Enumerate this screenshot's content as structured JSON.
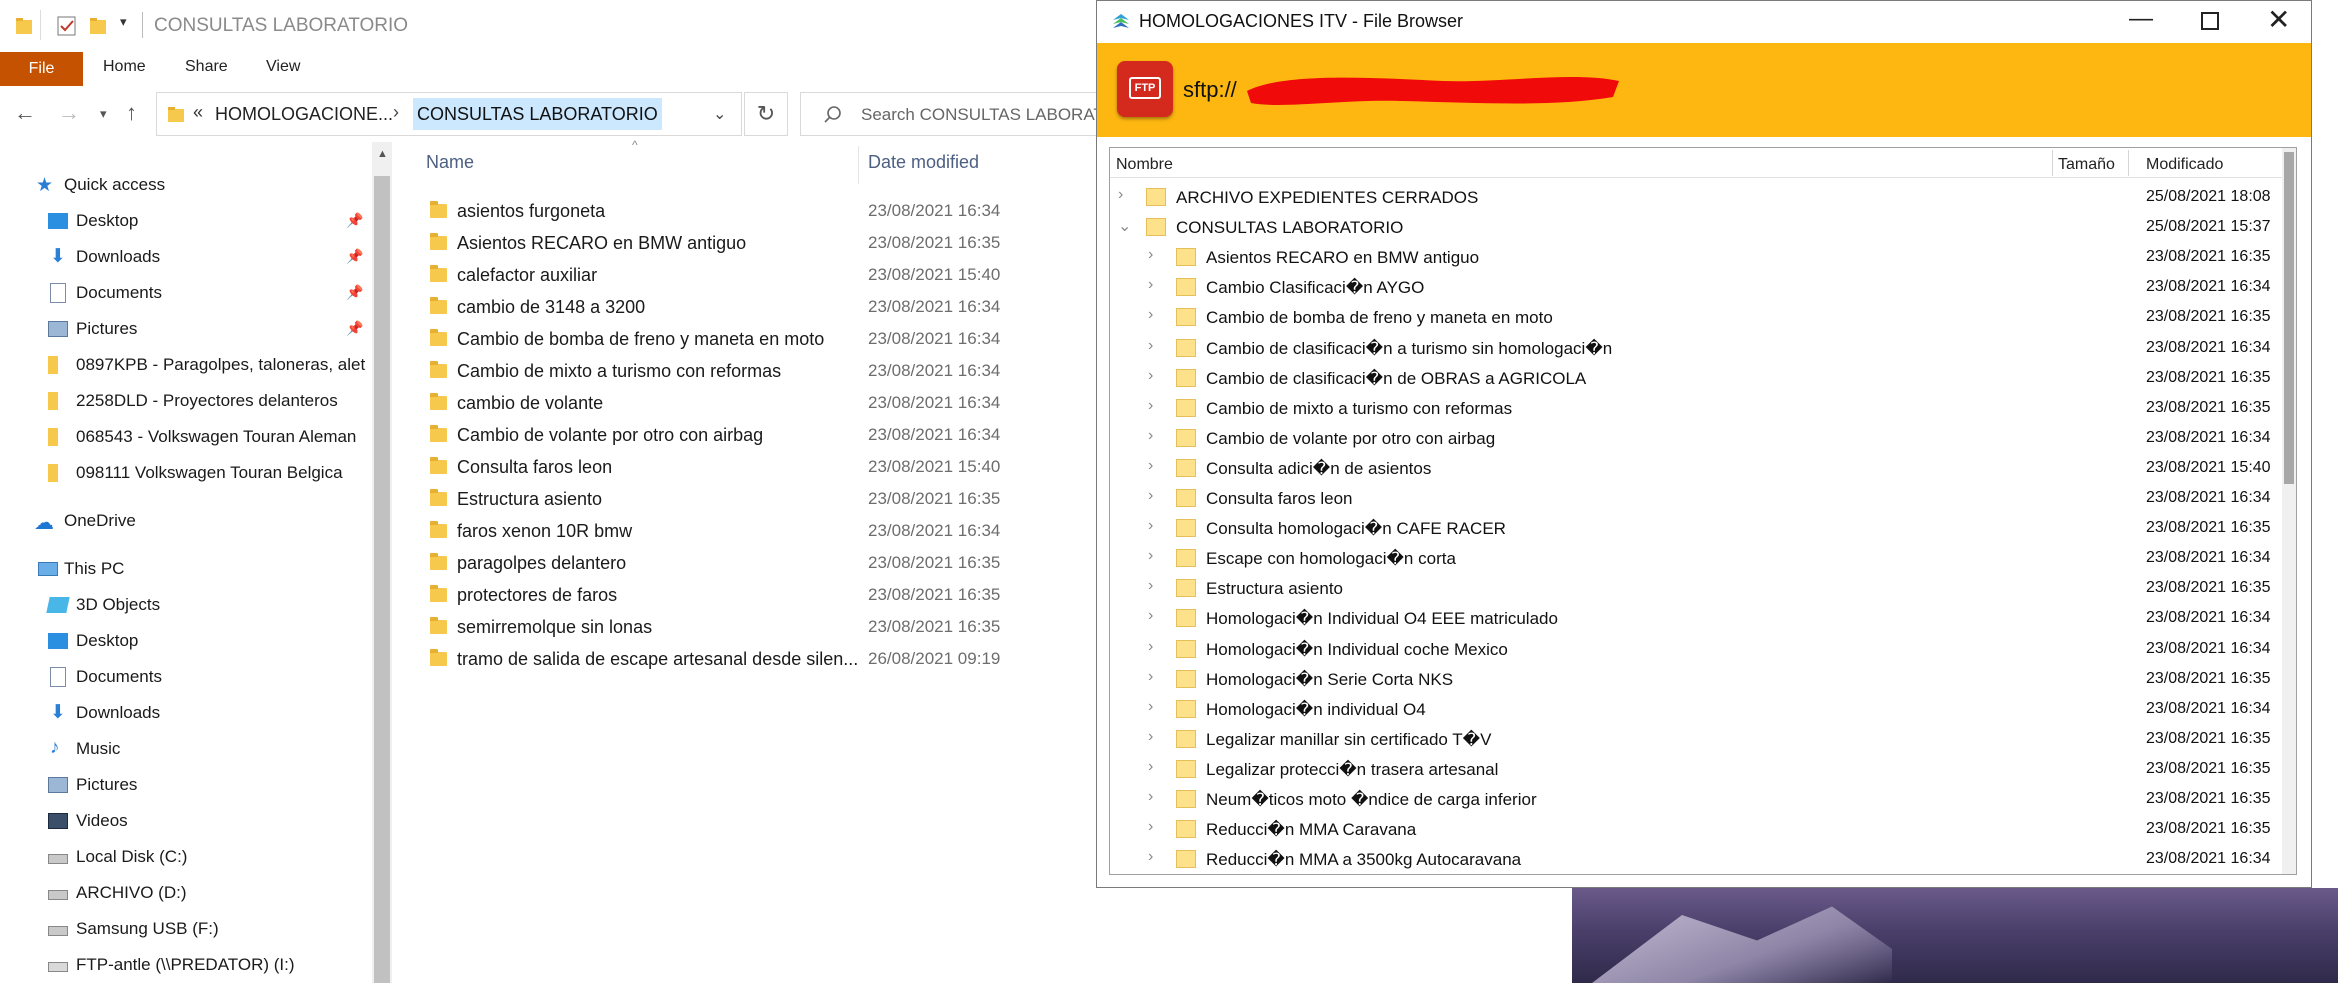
{
  "explorer": {
    "title": "CONSULTAS LABORATORIO",
    "ribbon": {
      "file": "File",
      "home": "Home",
      "share": "Share",
      "view": "View"
    },
    "address": {
      "chevron": "«",
      "crumb1": "HOMOLOGACIONE...",
      "sep": "›",
      "crumb2": "CONSULTAS LABORATORIO"
    },
    "search_placeholder": "Search CONSULTAS LABORAT",
    "nav": {
      "quick_access": "Quick access",
      "pinned": [
        "Desktop",
        "Downloads",
        "Documents",
        "Pictures"
      ],
      "recent": [
        "0897KPB - Paragolpes, taloneras, alet",
        "2258DLD - Proyectores delanteros",
        "068543 - Volkswagen Touran Aleman",
        "098111 Volkswagen Touran Belgica"
      ],
      "onedrive": "OneDrive",
      "this_pc": "This PC",
      "pc_items": [
        "3D Objects",
        "Desktop",
        "Documents",
        "Downloads",
        "Music",
        "Pictures",
        "Videos",
        "Local Disk (C:)",
        "ARCHIVO (D:)",
        "Samsung USB (F:)",
        "FTP-antle (\\\\PREDATOR) (I:)"
      ]
    },
    "columns": {
      "name": "Name",
      "date": "Date modified"
    },
    "files": [
      {
        "name": "asientos furgoneta",
        "date": "23/08/2021 16:34"
      },
      {
        "name": "Asientos RECARO en BMW antiguo",
        "date": "23/08/2021 16:35"
      },
      {
        "name": "calefactor auxiliar",
        "date": "23/08/2021 15:40"
      },
      {
        "name": "cambio de 3148 a 3200",
        "date": "23/08/2021 16:34"
      },
      {
        "name": "Cambio de bomba de freno y maneta en moto",
        "date": "23/08/2021 16:34"
      },
      {
        "name": "Cambio de mixto a turismo con reformas",
        "date": "23/08/2021 16:34"
      },
      {
        "name": "cambio de volante",
        "date": "23/08/2021 16:34"
      },
      {
        "name": "Cambio de volante por otro con airbag",
        "date": "23/08/2021 16:34"
      },
      {
        "name": "Consulta faros leon",
        "date": "23/08/2021 15:40"
      },
      {
        "name": "Estructura asiento",
        "date": "23/08/2021 16:35"
      },
      {
        "name": "faros xenon 10R bmw",
        "date": "23/08/2021 16:34"
      },
      {
        "name": "paragolpes delantero",
        "date": "23/08/2021 16:35"
      },
      {
        "name": "protectores de faros",
        "date": "23/08/2021 16:35"
      },
      {
        "name": "semirremolque sin lonas",
        "date": "23/08/2021 16:35"
      },
      {
        "name": "tramo de salida de escape artesanal desde silen...",
        "date": "26/08/2021 09:19"
      }
    ]
  },
  "filebrowser": {
    "title": "HOMOLOGACIONES ITV - File Browser",
    "url_prefix": "sftp://",
    "columns": {
      "name": "Nombre",
      "size": "Tamaño",
      "modified": "Modificado"
    },
    "root_items": [
      {
        "name": "ARCHIVO EXPEDIENTES CERRADOS",
        "date": "25/08/2021 18:08",
        "expanded": false
      },
      {
        "name": "CONSULTAS LABORATORIO",
        "date": "25/08/2021 15:37",
        "expanded": true
      }
    ],
    "children": [
      {
        "name": "Asientos RECARO en BMW antiguo",
        "date": "23/08/2021 16:35"
      },
      {
        "name": "Cambio Clasificaci�n AYGO",
        "date": "23/08/2021 16:34"
      },
      {
        "name": "Cambio de bomba de freno y maneta en moto",
        "date": "23/08/2021 16:35"
      },
      {
        "name": "Cambio de clasificaci�n a turismo sin homologaci�n",
        "date": "23/08/2021 16:34"
      },
      {
        "name": "Cambio de clasificaci�n de OBRAS a AGRICOLA",
        "date": "23/08/2021 16:35"
      },
      {
        "name": "Cambio de mixto a turismo con reformas",
        "date": "23/08/2021 16:35"
      },
      {
        "name": "Cambio de volante por otro con airbag",
        "date": "23/08/2021 16:34"
      },
      {
        "name": "Consulta adici�n de asientos",
        "date": "23/08/2021 15:40"
      },
      {
        "name": "Consulta faros leon",
        "date": "23/08/2021 16:34"
      },
      {
        "name": "Consulta homologaci�n CAFE RACER",
        "date": "23/08/2021 16:35"
      },
      {
        "name": "Escape con homologaci�n corta",
        "date": "23/08/2021 16:34"
      },
      {
        "name": "Estructura asiento",
        "date": "23/08/2021 16:35"
      },
      {
        "name": "Homologaci�n Individual O4 EEE matriculado",
        "date": "23/08/2021 16:34"
      },
      {
        "name": "Homologaci�n Individual coche Mexico",
        "date": "23/08/2021 16:34"
      },
      {
        "name": "Homologaci�n Serie Corta NKS",
        "date": "23/08/2021 16:35"
      },
      {
        "name": "Homologaci�n individual O4",
        "date": "23/08/2021 16:34"
      },
      {
        "name": "Legalizar manillar sin certificado T�V",
        "date": "23/08/2021 16:35"
      },
      {
        "name": "Legalizar protecci�n trasera artesanal",
        "date": "23/08/2021 16:35"
      },
      {
        "name": "Neum�ticos moto �ndice de carga inferior",
        "date": "23/08/2021 16:35"
      },
      {
        "name": "Reducci�n MMA Caravana",
        "date": "23/08/2021 16:35"
      },
      {
        "name": "Reducci�n MMA a 3500kg Autocaravana",
        "date": "23/08/2021 16:34"
      }
    ]
  },
  "colors": {
    "file_tab": "#c45200",
    "banner": "#fdb710",
    "folder": "#f6c84c",
    "selection": "#cce8ff"
  }
}
